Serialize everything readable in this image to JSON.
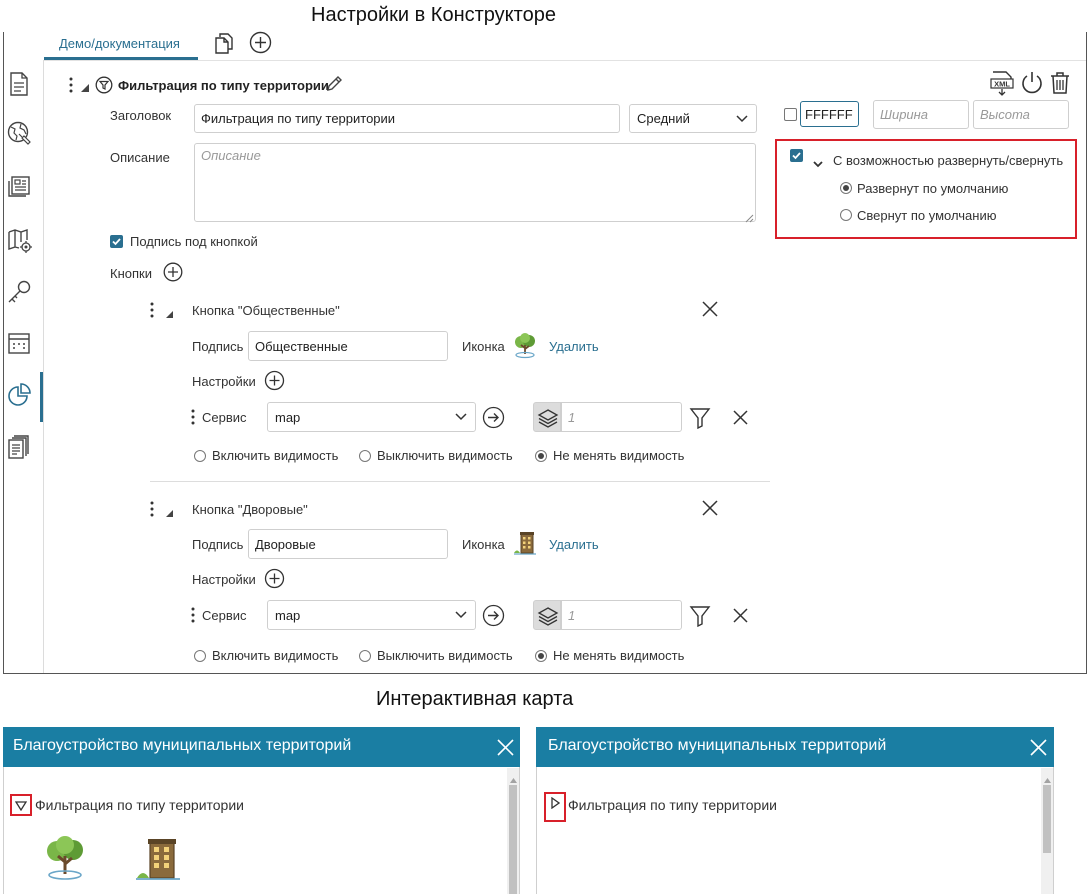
{
  "constructor": {
    "section_title": "Настройки в Конструкторе",
    "tab_label": "Демо/документация",
    "widget_title": "Фильтрация по типу территории",
    "fields": {
      "heading_label": "Заголовок",
      "heading_value": "Фильтрация по типу территории",
      "size_value": "Средний",
      "description_label": "Описание",
      "description_placeholder": "Описание",
      "caption_under_button_label": "Подпись под кнопкой",
      "buttons_label": "Кнопки"
    },
    "style": {
      "color_value": "FFFFFF",
      "width_placeholder": "Ширина",
      "height_placeholder": "Высота"
    },
    "collapse": {
      "label": "С возможностью развернуть/свернуть",
      "option_expanded": "Развернут по умолчанию",
      "option_collapsed": "Свернут по умолчанию"
    },
    "buttons": [
      {
        "title": "Кнопка \"Общественные\"",
        "caption_label": "Подпись",
        "caption_value": "Общественные",
        "icon_label": "Иконка",
        "delete_label": "Удалить",
        "settings_label": "Настройки",
        "service_label": "Сервис",
        "service_value": "map",
        "layer_placeholder": "1",
        "vis_on": "Включить видимость",
        "vis_off": "Выключить видимость",
        "vis_keep": "Не менять видимость"
      },
      {
        "title": "Кнопка \"Дворовые\"",
        "caption_label": "Подпись",
        "caption_value": "Дворовые",
        "icon_label": "Иконка",
        "delete_label": "Удалить",
        "settings_label": "Настройки",
        "service_label": "Сервис",
        "service_value": "map",
        "layer_placeholder": "1",
        "vis_on": "Включить видимость",
        "vis_off": "Выключить видимость",
        "vis_keep": "Не менять видимость"
      }
    ]
  },
  "map": {
    "section_title": "Интерактивная карта",
    "panels": [
      {
        "title": "Благоустройство муниципальных территорий",
        "filter_title": "Фильтрация по типу территории",
        "state": "expanded"
      },
      {
        "title": "Благоустройство муниципальных территорий",
        "filter_title": "Фильтрация по типу территории",
        "state": "collapsed"
      }
    ]
  },
  "colors": {
    "accent": "#2a6f90",
    "panel_header": "#1a7ea3",
    "highlight": "#d8202a"
  },
  "icons": [
    "document-icon",
    "globe-icon",
    "news-icon",
    "map-settings-icon",
    "key-icon",
    "calendar-icon",
    "pie-chart-icon",
    "pages-icon",
    "copy-icon",
    "add-icon",
    "filter-icon",
    "pencil-icon",
    "xml-icon",
    "power-icon",
    "trash-icon",
    "close-icon",
    "arrow-right-icon",
    "layers-icon",
    "tree-icon",
    "building-icon"
  ]
}
